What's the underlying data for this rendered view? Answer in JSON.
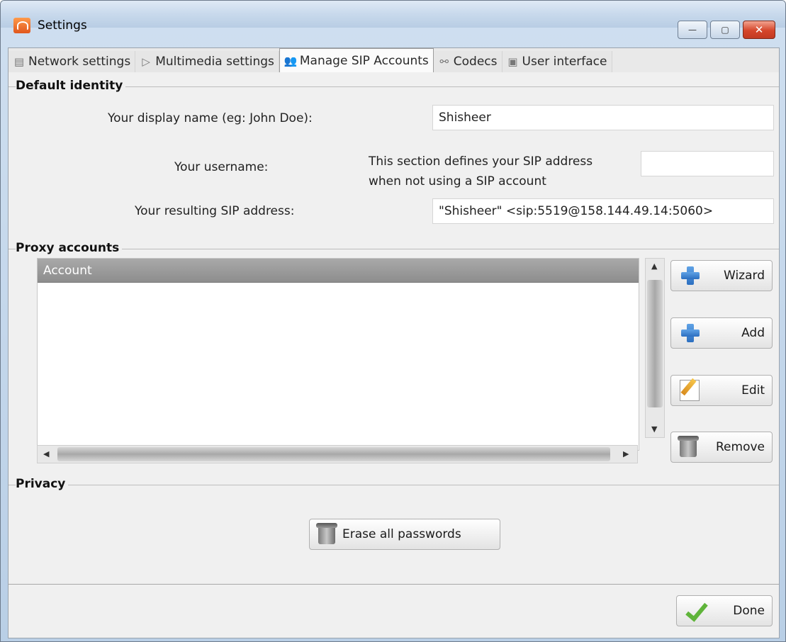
{
  "window": {
    "title": "Settings",
    "minimize_glyph": "—",
    "maximize_glyph": "▢",
    "close_glyph": "✕"
  },
  "tabs": [
    {
      "label": "Network settings",
      "icon": "network-icon",
      "glyph": "▤"
    },
    {
      "label": "Multimedia settings",
      "icon": "play-icon",
      "glyph": "▷"
    },
    {
      "label": "Manage SIP Accounts",
      "icon": "users-icon",
      "glyph": "👥"
    },
    {
      "label": "Codecs",
      "icon": "link-icon",
      "glyph": "⚯"
    },
    {
      "label": "User interface",
      "icon": "ui-icon",
      "glyph": "▣"
    }
  ],
  "active_tab": "Manage SIP Accounts",
  "default_identity": {
    "title": "Default identity",
    "display_name_label": "Your display name (eg: John Doe):",
    "display_name_value": "Shisheer",
    "username_label": "Your username:",
    "username_note_line1": "This section defines your SIP address",
    "username_note_line2": "when not using a SIP account",
    "username_value": "",
    "sip_address_label": "Your resulting SIP address:",
    "sip_address_value": "\"Shisheer\" <sip:5519@158.144.49.14:5060>"
  },
  "proxy_accounts": {
    "title": "Proxy accounts",
    "column_header": "Account",
    "rows": [],
    "buttons": {
      "wizard": "Wizard",
      "add": "Add",
      "edit": "Edit",
      "remove": "Remove"
    }
  },
  "privacy": {
    "title": "Privacy",
    "erase_button": "Erase all passwords"
  },
  "footer": {
    "done_button": "Done"
  }
}
